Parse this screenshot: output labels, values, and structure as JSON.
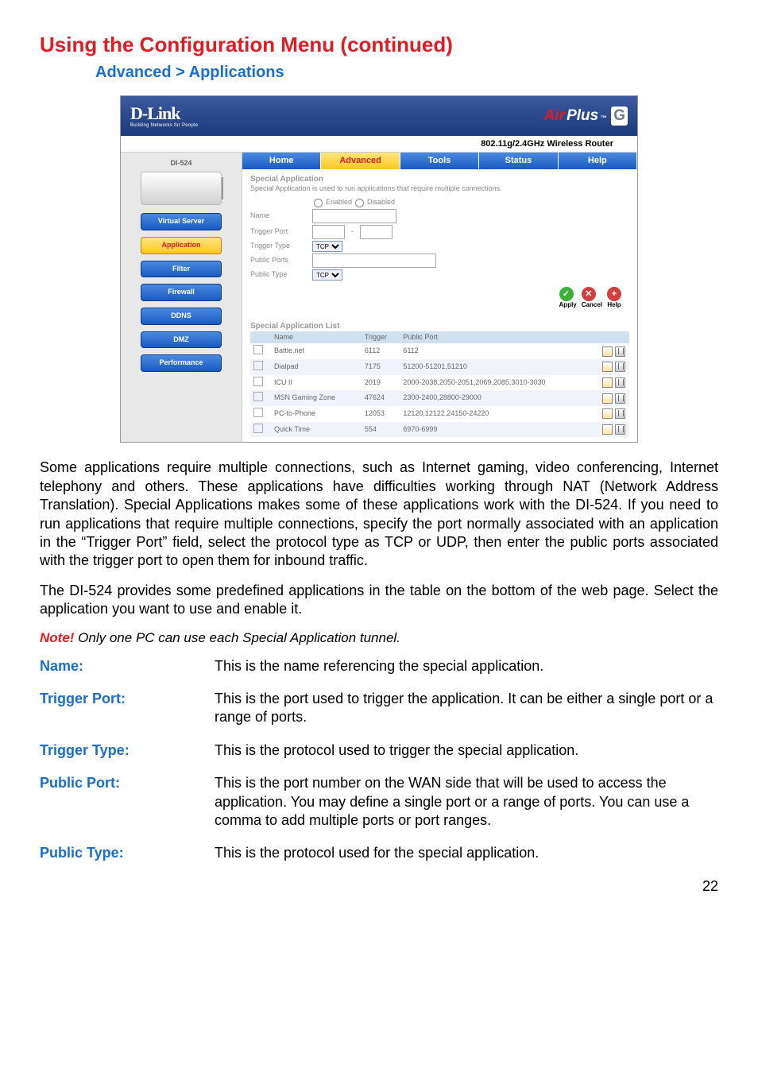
{
  "page": {
    "title": "Using the Configuration Menu (continued)",
    "breadcrumb": "Advanced > Applications",
    "number": "22"
  },
  "router": {
    "brand": "D-Link",
    "brand_sub": "Building Networks for People",
    "product_air": "Air",
    "product_plus": "Plus",
    "product_tm": "™",
    "product_g": "G",
    "subtitle": "802.11g/2.4GHz Wireless Router",
    "model": "DI-524",
    "tabs": {
      "home": "Home",
      "advanced": "Advanced",
      "tools": "Tools",
      "status": "Status",
      "help": "Help"
    },
    "nav": {
      "virtual_server": "Virtual Server",
      "application": "Application",
      "filter": "Filter",
      "firewall": "Firewall",
      "ddns": "DDNS",
      "dmz": "DMZ",
      "performance": "Performance"
    },
    "section_title": "Special Application",
    "section_desc": "Special Application is used to run applications that require multiple connections.",
    "enabled": "Enabled",
    "disabled": "Disabled",
    "form": {
      "name": "Name",
      "trigger_port": "Trigger Port",
      "trigger_type": "Trigger Type",
      "public_ports": "Public Ports",
      "public_type": "Public Type",
      "tcp": "TCP"
    },
    "actions": {
      "apply": "Apply",
      "cancel": "Cancel",
      "help": "Help"
    },
    "list_title": "Special Application List",
    "list_headers": {
      "name": "Name",
      "trigger": "Trigger",
      "public_port": "Public Port"
    },
    "list": [
      {
        "name": "Battle.net",
        "trigger": "6112",
        "public": "6112"
      },
      {
        "name": "Dialpad",
        "trigger": "7175",
        "public": "51200-51201,51210"
      },
      {
        "name": "ICU II",
        "trigger": "2019",
        "public": "2000-2038,2050-2051,2069,2085,3010-3030"
      },
      {
        "name": "MSN Gaming Zone",
        "trigger": "47624",
        "public": "2300-2400,28800-29000"
      },
      {
        "name": "PC-to-Phone",
        "trigger": "12053",
        "public": "12120,12122,24150-24220"
      },
      {
        "name": "Quick Time",
        "trigger": "554",
        "public": "6970-6999"
      }
    ]
  },
  "body": {
    "para1": "Some applications require multiple connections, such as Internet gaming, video conferencing, Internet telephony and others. These applications have difficulties working through NAT (Network Address Translation). Special Applications makes some of these applications work with the DI-524. If you need to run applications that require multiple connections, specify the port normally associated with an application in the “Trigger Port” field, select the protocol type as TCP or UDP, then enter the public ports associated with the trigger port to open them for inbound traffic.",
    "para2": "The DI-524 provides some predefined applications in the table on the bottom of the web page. Select the application you want to use and enable it.",
    "note_label": "Note!",
    "note_text": " Only one PC can use each Special Application tunnel."
  },
  "defs": {
    "name": {
      "label": "Name:",
      "text": "This is the name referencing the special application."
    },
    "trigger_port": {
      "label": "Trigger Port:",
      "text": "This is the port used to trigger the application. It can be either a single port or a range of ports."
    },
    "trigger_type": {
      "label": "Trigger Type:",
      "text": "This is the protocol used to trigger the special application."
    },
    "public_port": {
      "label": "Public Port:",
      "text": "This is the port number on the WAN side that will be used to access the application. You may define a single port or a range of ports. You can use a comma to add multiple ports or port ranges."
    },
    "public_type": {
      "label": "Public Type:",
      "text": "This is the protocol used for the special application."
    }
  }
}
